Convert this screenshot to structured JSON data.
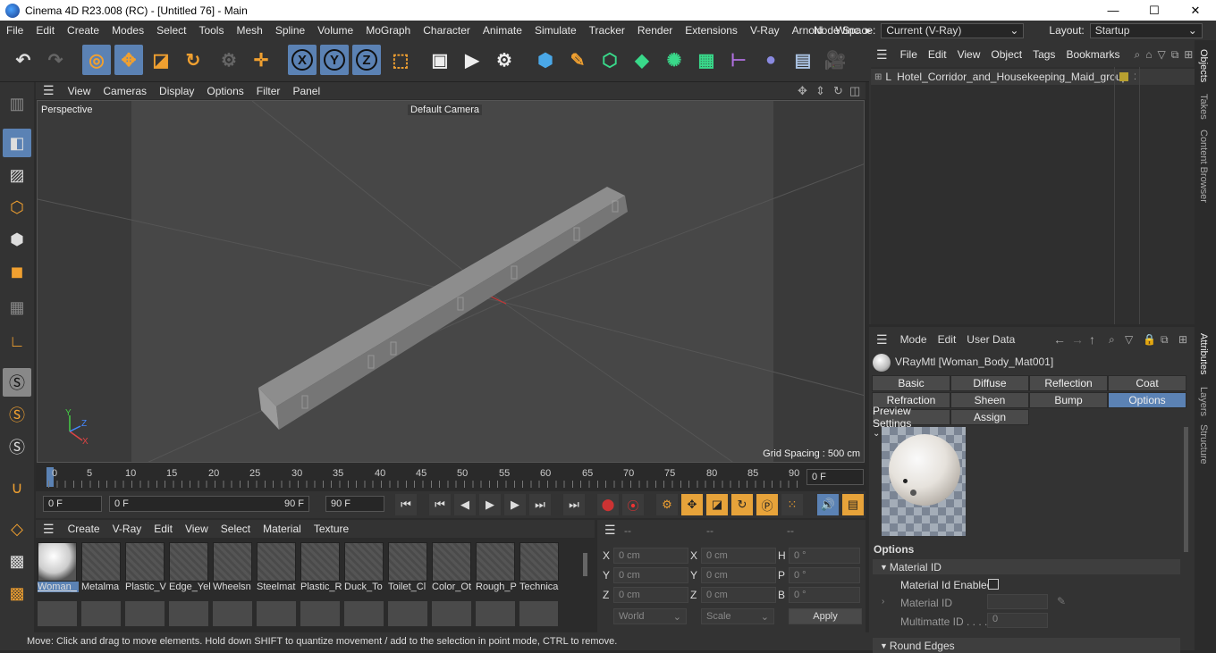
{
  "window": {
    "title": "Cinema 4D R23.008 (RC) - [Untitled 76] - Main",
    "min": "—",
    "max": "☐",
    "close": "✕"
  },
  "menu": [
    "File",
    "Edit",
    "Create",
    "Modes",
    "Select",
    "Tools",
    "Mesh",
    "Spline",
    "Volume",
    "MoGraph",
    "Character",
    "Animate",
    "Simulate",
    "Tracker",
    "Render",
    "Extensions",
    "V-Ray",
    "Arnold",
    "Winc"
  ],
  "node_space": {
    "label": "Node Space:",
    "value": "Current (V-Ray)"
  },
  "layout": {
    "label": "Layout:",
    "value": "Startup"
  },
  "toolbar": {
    "x": "X",
    "y": "Y",
    "z": "Z"
  },
  "viewport": {
    "menu": [
      "View",
      "Cameras",
      "Display",
      "Options",
      "Filter",
      "Panel"
    ],
    "perspective": "Perspective",
    "camera": "Default Camera",
    "grid_spacing": "Grid Spacing : 500 cm",
    "axis_x": "X",
    "axis_y": "Y",
    "axis_z": "Z"
  },
  "timeline": {
    "ticks": [
      "0",
      "5",
      "10",
      "15",
      "20",
      "25",
      "30",
      "35",
      "40",
      "45",
      "50",
      "55",
      "60",
      "65",
      "70",
      "75",
      "80",
      "85",
      "90"
    ],
    "current_frame": "0 F"
  },
  "transport": {
    "start": "0 F",
    "range_start": "0 F",
    "range_end": "90 F",
    "end": "90 F"
  },
  "material_manager": {
    "menu": [
      "Create",
      "V-Ray",
      "Edit",
      "View",
      "Select",
      "Material",
      "Texture"
    ],
    "materials": [
      "Woman_",
      "Metalma",
      "Plastic_V",
      "Edge_Yel",
      "Wheelsn",
      "Steelmat",
      "Plastic_R",
      "Duck_To",
      "Toilet_Cl",
      "Color_Ot",
      "Rough_P",
      "Technica"
    ]
  },
  "coordinates": {
    "headers": [
      "--",
      "--",
      "--"
    ],
    "rows": [
      {
        "a": "X",
        "av": "0 cm",
        "b": "X",
        "bv": "0 cm",
        "c": "H",
        "cv": "0 °"
      },
      {
        "a": "Y",
        "av": "0 cm",
        "b": "Y",
        "bv": "0 cm",
        "c": "P",
        "cv": "0 °"
      },
      {
        "a": "Z",
        "av": "0 cm",
        "b": "Z",
        "bv": "0 cm",
        "c": "B",
        "cv": "0 °"
      }
    ],
    "world": "World",
    "scale": "Scale",
    "apply": "Apply"
  },
  "status": "Move: Click and drag to move elements. Hold down SHIFT to quantize movement / add to the selection in point mode, CTRL to remove.",
  "object_manager": {
    "menu": [
      "File",
      "Edit",
      "View",
      "Object",
      "Tags",
      "Bookmarks"
    ],
    "objects": [
      "Hotel_Corridor_and_Housekeeping_Maid_group"
    ]
  },
  "attributes": {
    "menu": [
      "Mode",
      "Edit",
      "User Data"
    ],
    "material_title": "VRayMtl [Woman_Body_Mat001]",
    "tabs_row1": [
      "Basic",
      "Diffuse",
      "Reflection",
      "Coat"
    ],
    "tabs_row2": [
      "Refraction",
      "Sheen",
      "Bump",
      "Options"
    ],
    "tabs_row3": [
      "Preview Settings",
      "Assign"
    ],
    "section": "Options",
    "group": "Material ID",
    "fields": {
      "enabled": "Material Id Enabled",
      "id": "Material ID",
      "multimatte": "Multimatte ID . . . .",
      "multimatte_val": "0"
    },
    "next_group": "Round Edges"
  },
  "side_tabs": [
    "Objects",
    "Takes",
    "Content Browser",
    "Attributes",
    "Layers",
    "Structure"
  ]
}
